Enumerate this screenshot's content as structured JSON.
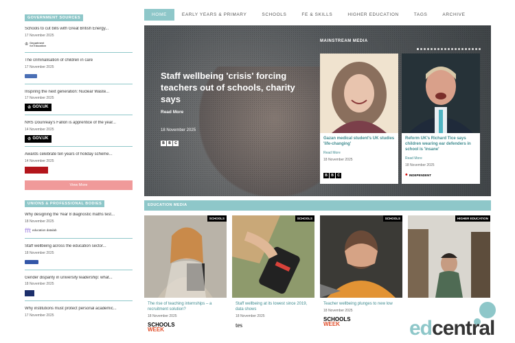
{
  "nav": {
    "items": [
      "HOME",
      "EARLY YEARS & PRIMARY",
      "SCHOOLS",
      "FE & SKILLS",
      "HIGHER EDUCATION",
      "TAGS",
      "ARCHIVE"
    ]
  },
  "sidebar": {
    "gov_heading": "GOVERNMENT SOURCES",
    "gov_items": [
      {
        "title": "Schools to cut bills with Great British Energy...",
        "date": "17 November 2025",
        "logo": "dfe-logo"
      },
      {
        "title": "The criminalisation of children in care",
        "date": "17 November 2025",
        "logo": "small-logo"
      },
      {
        "title": "Inspiring the next generation: Nuclear Waste...",
        "date": "17 November 2025",
        "logo": "GOV.UK"
      },
      {
        "title": "NRS Dounreay's Fallon is apprentice of the year...",
        "date": "14 November 2025",
        "logo": "GOV.UK"
      },
      {
        "title": "Awards celebrate ten years of holiday scheme...",
        "date": "14 November 2025",
        "logo": "red-logo"
      }
    ],
    "view_more": "View More",
    "unions_heading": "UNIONS & PROFESSIONAL BODIES",
    "union_items": [
      {
        "title": "Why designing the Year 8 diagnostic maths test...",
        "date": "18 November 2025",
        "logo_text": "education datalab"
      },
      {
        "title": "Staff wellbeing across the education sector...",
        "date": "18 November 2025"
      },
      {
        "title": "Gender disparity in university leadership: what...",
        "date": "18 November 2025"
      },
      {
        "title": "Why institutions must protect personal academic...",
        "date": "17 November 2025"
      }
    ]
  },
  "hero": {
    "title": "Staff wellbeing 'crisis' forcing teachers out of schools, charity says",
    "read_more": "Read More",
    "date": "18 November 2025",
    "source_letters": [
      "B",
      "B",
      "C"
    ]
  },
  "mainstream": {
    "heading": "MAINSTREAM MEDIA",
    "cards": [
      {
        "title": "Gazan medical student's UK studies 'life-changing'",
        "read_more": "Read More",
        "date": "18 November 2025",
        "source": "BBC"
      },
      {
        "title": "Reform UK's Richard Tice says children wearing ear defenders in school is 'insane'",
        "read_more": "Read More",
        "date": "18 November 2025",
        "source": "INDEPENDENT"
      }
    ]
  },
  "education_media": {
    "heading": "EDUCATION MEDIA",
    "cards": [
      {
        "tag": "SCHOOLS",
        "title": "The rise of teaching internships – a recruitment solution?",
        "date": "18 November 2025",
        "logo": "SCHOOLS WEEK"
      },
      {
        "tag": "SCHOOLS",
        "title": "Staff wellbeing at its lowest since 2019, data shows",
        "date": "18 November 2025",
        "logo": "tes"
      },
      {
        "tag": "SCHOOLS",
        "title": "Teacher wellbeing plunges to new low",
        "date": "18 November 2025",
        "logo": "SCHOOLS WEEK"
      },
      {
        "tag": "HIGHER EDUCATION",
        "title": "",
        "date": "",
        "logo": ""
      }
    ]
  },
  "brand": {
    "part1": "ed",
    "part2": "central"
  },
  "colors": {
    "accent": "#8ec7c9",
    "link": "#3d8a8e",
    "button": "#f09a9a"
  }
}
